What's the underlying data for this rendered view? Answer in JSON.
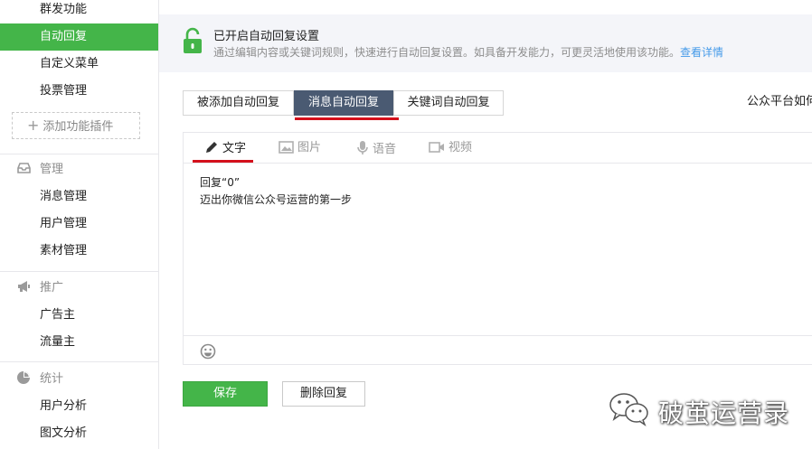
{
  "sidebar": {
    "top_items": [
      {
        "label": "群发功能"
      },
      {
        "label": "自动回复",
        "active": true
      },
      {
        "label": "自定义菜单"
      },
      {
        "label": "投票管理"
      }
    ],
    "add_plugin_label": "添加功能插件",
    "groups": [
      {
        "title": "管理",
        "icon": "inbox-icon",
        "items": [
          "消息管理",
          "用户管理",
          "素材管理"
        ]
      },
      {
        "title": "推广",
        "icon": "megaphone-icon",
        "items": [
          "广告主",
          "流量主"
        ]
      },
      {
        "title": "统计",
        "icon": "pie-chart-icon",
        "items": [
          "用户分析",
          "图文分析"
        ]
      }
    ]
  },
  "banner": {
    "title": "已开启自动回复设置",
    "description": "通过编辑内容或关键词规则，快速进行自动回复设置。如具备开发能力，可更灵活地使用该功能。",
    "link": "查看详情"
  },
  "tabs": [
    "被添加自动回复",
    "消息自动回复",
    "关键词自动回复"
  ],
  "active_tab": "消息自动回复",
  "right_text": "公众平台如何",
  "editor": {
    "media_tabs": [
      "文字",
      "图片",
      "语音",
      "视频"
    ],
    "active_media": "文字",
    "content_lines": [
      "回复“0”",
      "迈出你微信公众号运营的第一步"
    ]
  },
  "buttons": {
    "save": "保存",
    "delete": "删除回复"
  },
  "watermark": "破茧运营录",
  "colors": {
    "accent": "#44b549",
    "active_tab": "#4a5a72",
    "underline": "#d4101c",
    "link": "#459ae9"
  }
}
